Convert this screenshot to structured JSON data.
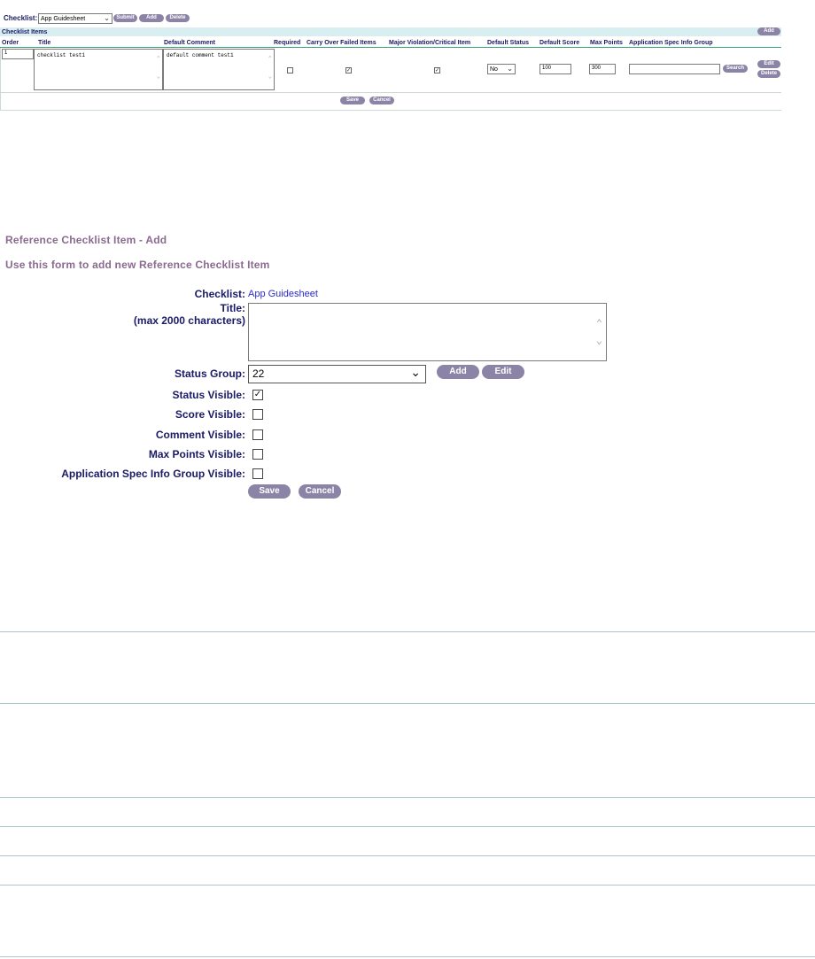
{
  "toolbar": {
    "checklist_label": "Checklist:",
    "checklist_value": "App Guidesheet",
    "submit_label": "Submit",
    "add_label": "Add",
    "delete_label": "Delete"
  },
  "grid": {
    "title": "Checklist Items",
    "add_label": "Add",
    "columns": [
      "Order",
      "Title",
      "Default Comment",
      "Required",
      "Carry Over Failed Items",
      "Major Violation/Critical Item",
      "Default Status",
      "Default Score",
      "Max Points",
      "Application Spec Info Group"
    ],
    "row": {
      "order": "1",
      "title": "checklist test1",
      "default_comment": "default comment test1",
      "required": false,
      "carry_over": true,
      "major_violation": true,
      "default_status": "No",
      "default_score": "100",
      "max_points": "300",
      "spec_info_group": "",
      "search_label": "Search",
      "edit_label": "Edit",
      "delete_label": "Delete"
    },
    "save_label": "Save",
    "cancel_label": "Cancel"
  },
  "form": {
    "heading": "Reference Checklist Item - Add",
    "subheading": "Use this form to add new Reference Checklist Item",
    "checklist_label": "Checklist:",
    "checklist_value": "App Guidesheet",
    "title_label": "Title:",
    "title_hint": "(max 2000 characters)",
    "title_value": "",
    "status_group_label": "Status Group:",
    "status_group_value": "22",
    "add_label": "Add",
    "edit_label": "Edit",
    "status_visible_label": "Status Visible:",
    "status_visible": true,
    "score_visible_label": "Score Visible:",
    "score_visible": false,
    "comment_visible_label": "Comment Visible:",
    "comment_visible": false,
    "max_points_visible_label": "Max Points Visible:",
    "max_points_visible": false,
    "spec_info_visible_label": "Application Spec Info Group Visible:",
    "spec_info_visible": false,
    "save_label": "Save",
    "cancel_label": "Cancel"
  },
  "icons": {
    "dropdown": "chevron-down-icon",
    "check": "checkmark-icon",
    "scroll_up": "scroll-up-icon",
    "scroll_down": "scroll-down-icon"
  },
  "colors": {
    "button": "#8c84a6",
    "heading": "#8a6a8f",
    "label": "#1a1a66",
    "link": "#2b2bd0",
    "header_bar": "#d9eef0",
    "grid_line": "#3aa37a",
    "separator": "#a8c8cc"
  }
}
